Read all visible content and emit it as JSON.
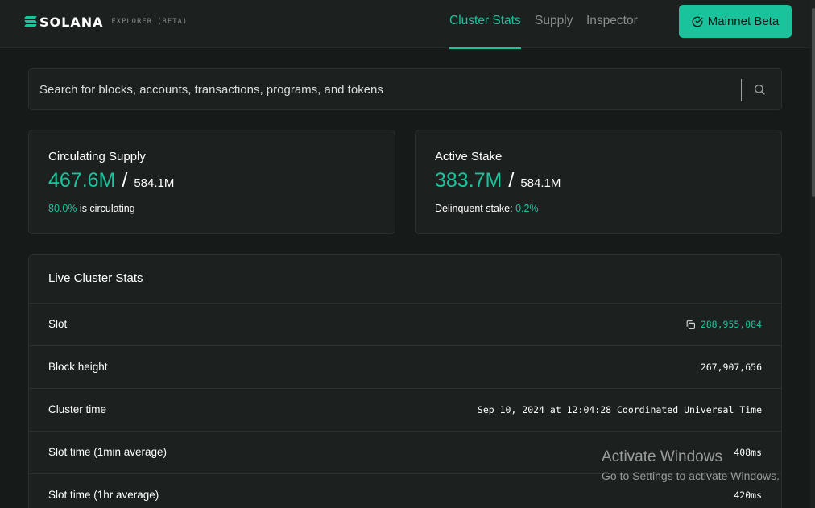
{
  "nav": {
    "logo": "SOLANA",
    "logo_sub": "EXPLORER (BETA)",
    "links": [
      "Cluster Stats",
      "Supply",
      "Inspector"
    ],
    "cluster_button": "Mainnet Beta"
  },
  "search": {
    "placeholder": "Search for blocks, accounts, transactions, programs, and tokens"
  },
  "supply_card": {
    "title": "Circulating Supply",
    "value": "467.6M",
    "total": "584.1M",
    "pct": "80.0%",
    "pct_suffix": " is circulating"
  },
  "stake_card": {
    "title": "Active Stake",
    "value": "383.7M",
    "total": "584.1M",
    "foot_label": "Delinquent stake: ",
    "foot_value": "0.2%"
  },
  "stats": {
    "title": "Live Cluster Stats",
    "rows": [
      {
        "label": "Slot",
        "value": "288,955,084"
      },
      {
        "label": "Block height",
        "value": "267,907,656"
      },
      {
        "label": "Cluster time",
        "value": "Sep 10, 2024 at 12:04:28 Coordinated Universal Time"
      },
      {
        "label": "Slot time (1min average)",
        "value": "408ms"
      },
      {
        "label": "Slot time (1hr average)",
        "value": "420ms"
      }
    ]
  },
  "watermark": {
    "line1": "Activate Windows",
    "line2": "Go to Settings to activate Windows."
  },
  "colors": {
    "accent": "#19c39c",
    "background": "#161a19",
    "card": "#1c2120"
  }
}
